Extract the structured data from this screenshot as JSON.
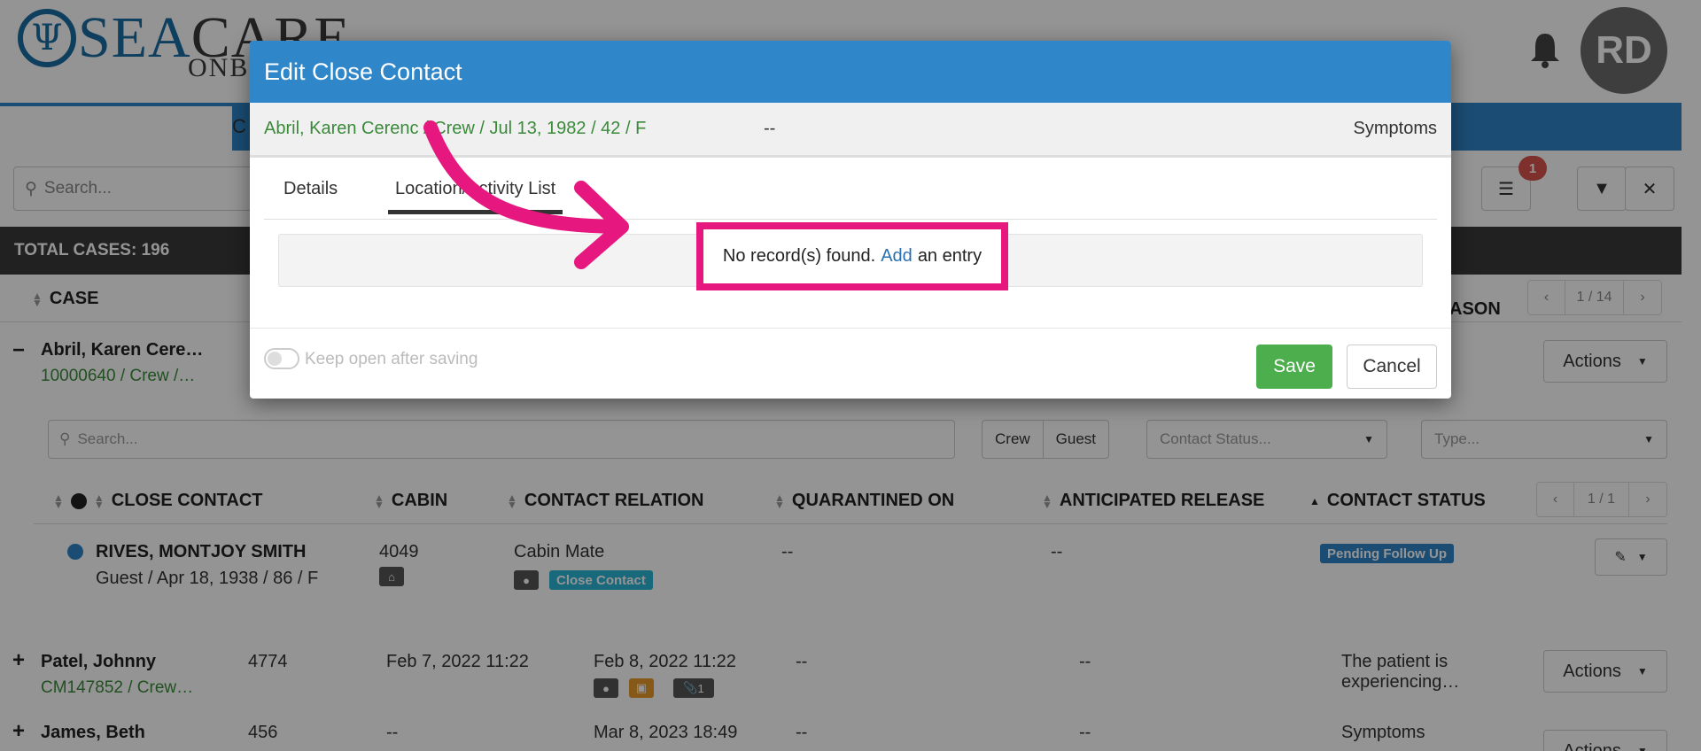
{
  "header": {
    "logo_main": "SEA",
    "logo_care": "CARE",
    "logo_sub": "ONB",
    "avatar_initials": "RD",
    "nav_partial": "C"
  },
  "filters": {
    "search_placeholder": "Search...",
    "notification_count": "1"
  },
  "case_list": {
    "total": "TOTAL CASES: 196",
    "columns": {
      "case": "CASE",
      "reason": "ASON"
    },
    "pager": {
      "prev": "‹",
      "page": "1 / 14",
      "next": "›"
    },
    "rows": [
      {
        "name": "Abril, Karen Cere…",
        "sub": "10000640 / Crew /…",
        "actions": "Actions"
      },
      {
        "name": "Patel, Johnny",
        "sub": "CM147852 / Crew…",
        "cabin": "4774",
        "date1": "Feb 7, 2022 11:22",
        "date2": "Feb 8, 2022 11:22",
        "col5": "--",
        "col6": "--",
        "reason": "The patient is experiencing…",
        "chip_count": "1",
        "actions": "Actions"
      },
      {
        "name": "James, Beth",
        "cabin": "456",
        "date1": "--",
        "date2": "Mar 8, 2023 18:49",
        "col5": "--",
        "col6": "--",
        "reason": "Symptoms",
        "actions": "Actions"
      }
    ]
  },
  "close_contacts": {
    "search_placeholder": "Search...",
    "segments": [
      "Crew",
      "Guest"
    ],
    "contact_status_placeholder": "Contact Status...",
    "type_placeholder": "Type...",
    "columns": {
      "close_contact": "CLOSE CONTACT",
      "cabin": "CABIN",
      "contact_relation": "CONTACT RELATION",
      "quarantined_on": "QUARANTINED ON",
      "anticipated_release": "ANTICIPATED RELEASE",
      "contact_status": "CONTACT STATUS"
    },
    "pager": {
      "prev": "‹",
      "page": "1 / 1",
      "next": "›"
    },
    "row": {
      "name": "RIVES, MONTJOY SMITH",
      "sub": "Guest / Apr 18, 1938 / 86 / F",
      "cabin": "4049",
      "relation": "Cabin Mate",
      "relation_tag": "Close Contact",
      "quarantined": "--",
      "release": "--",
      "status": "Pending Follow Up"
    }
  },
  "modal": {
    "title": "Edit Close Contact",
    "patient": "Abril, Karen Cerenc / Crew / Jul 13, 1982 / 42 / F",
    "dash": "--",
    "symptoms": "Symptoms",
    "tabs": [
      "Details",
      "Location/Activity List"
    ],
    "empty_text": "No record(s) found.",
    "empty_link": "Add",
    "empty_suffix": "an entry",
    "keep_open": "Keep open after saving",
    "save": "Save",
    "cancel": "Cancel"
  },
  "colors": {
    "brand_blue": "#2f86c8",
    "success_green": "#4cae4c",
    "highlight_pink": "#e6177e",
    "patient_green": "#3a8a3a"
  }
}
